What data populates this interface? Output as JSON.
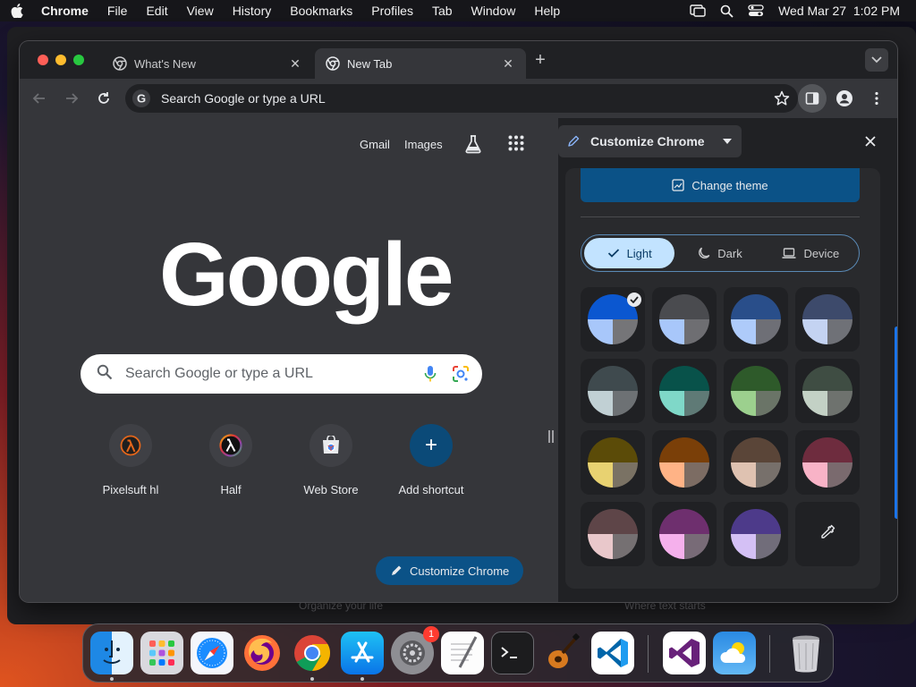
{
  "menubar": {
    "app_name": "Chrome",
    "items": [
      "File",
      "Edit",
      "View",
      "History",
      "Bookmarks",
      "Profiles",
      "Tab",
      "Window",
      "Help"
    ],
    "clock": "Wed Mar 27  1:02 PM"
  },
  "background": {
    "strip_left": "Organize your life",
    "strip_right": "Where text starts"
  },
  "tabs": [
    {
      "title": "What's New",
      "active": false
    },
    {
      "title": "New Tab",
      "active": true
    }
  ],
  "omnibox": {
    "placeholder": "Search Google or type a URL"
  },
  "ntp": {
    "links": {
      "gmail": "Gmail",
      "images": "Images"
    },
    "logo": "Google",
    "search_placeholder": "Search Google or type a URL",
    "shortcuts": [
      {
        "label": "Pixelsuft hl",
        "icon": "half-life-icon"
      },
      {
        "label": "Half",
        "icon": "lambda-icon"
      },
      {
        "label": "Web Store",
        "icon": "web-store-icon"
      },
      {
        "label": "Add shortcut",
        "icon": "plus-icon"
      }
    ],
    "customize_button": "Customize Chrome"
  },
  "side_panel": {
    "title": "Customize Chrome",
    "change_theme": "Change theme",
    "modes": [
      {
        "label": "Light",
        "selected": true
      },
      {
        "label": "Dark",
        "selected": false
      },
      {
        "label": "Device",
        "selected": false
      }
    ],
    "swatches": [
      {
        "top": "#0b57d0",
        "left": "#a8c7fa",
        "right": "#757578",
        "selected": true
      },
      {
        "top": "#4a4b4f",
        "left": "#a8c7fa",
        "right": "#6e6e72",
        "selected": false
      },
      {
        "top": "#294e8a",
        "left": "#aecbfa",
        "right": "#6e6f76",
        "selected": false
      },
      {
        "top": "#3d4a6b",
        "left": "#c4d3f2",
        "right": "#6f7177",
        "selected": false
      },
      {
        "top": "#3f4a4e",
        "left": "#c1d0d4",
        "right": "#6d7174",
        "selected": false
      },
      {
        "top": "#08524a",
        "left": "#7fd8c8",
        "right": "#5f7a76",
        "selected": false
      },
      {
        "top": "#2e5a2a",
        "left": "#9cd08e",
        "right": "#6a7467",
        "selected": false
      },
      {
        "top": "#3f4d43",
        "left": "#c3d1c5",
        "right": "#6e726e",
        "selected": false
      },
      {
        "top": "#5b4b08",
        "left": "#e8d271",
        "right": "#7a7264",
        "selected": false
      },
      {
        "top": "#7a3f08",
        "left": "#ffb386",
        "right": "#7c6c63",
        "selected": false
      },
      {
        "top": "#5a4538",
        "left": "#dfc2b1",
        "right": "#77706b",
        "selected": false
      },
      {
        "top": "#6e2c3e",
        "left": "#f8b3c7",
        "right": "#7a6a6e",
        "selected": false
      },
      {
        "top": "#5e4548",
        "left": "#e9c8cb",
        "right": "#757072",
        "selected": false
      },
      {
        "top": "#6e2f6e",
        "left": "#f5b0ec",
        "right": "#786b77",
        "selected": false
      },
      {
        "top": "#4d3a8a",
        "left": "#d4c0f5",
        "right": "#716d7a",
        "selected": false
      }
    ],
    "custom_color_icon": "eyedropper-icon"
  },
  "dock": {
    "apps": [
      "Finder",
      "Launchpad",
      "Safari",
      "Firefox",
      "Chrome",
      "App Store",
      "System Settings",
      "TextEdit",
      "Terminal",
      "GarageBand",
      "Visual Studio Code",
      "Visual Studio",
      "Weather",
      "Trash"
    ],
    "settings_badge": "1"
  },
  "colors": {
    "accent_blue": "#0b5287",
    "selected_mode_bg": "#c2e3ff",
    "window_bg": "#35363a",
    "panel_bg": "#202124"
  }
}
